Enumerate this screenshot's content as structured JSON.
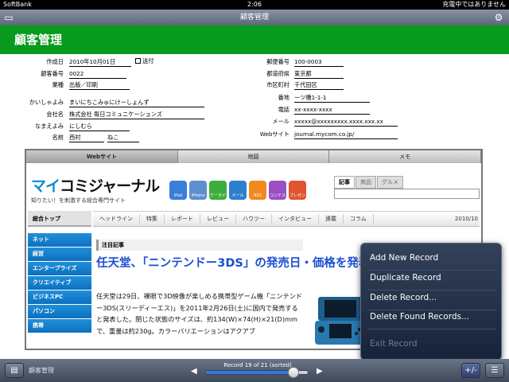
{
  "status_bar": {
    "carrier": "SoftBank",
    "time": "2:06",
    "charging": "充電中ではありません"
  },
  "title_bar": {
    "title": "顧客管理"
  },
  "header": {
    "title": "顧客管理"
  },
  "form_left": [
    {
      "label": "作成日",
      "value": "2010年10月01日"
    },
    {
      "label": "顧客番号",
      "value": "0022"
    },
    {
      "label": "業種",
      "value": "出版／印刷"
    },
    {
      "label": "かいしゃよみ",
      "value": "まいにちこみゅにけーしょんず"
    },
    {
      "label": "会社名",
      "value": "株式会社 毎日コミュニケーションズ"
    },
    {
      "label": "なまえよみ",
      "value": "にしむら"
    },
    {
      "label": "名前",
      "value_last": "西村",
      "value_first": "ねこ"
    }
  ],
  "sent_checkbox_label": "送付",
  "form_right": [
    {
      "label": "郵便番号",
      "value": "100-0003"
    },
    {
      "label": "都道府県",
      "value": "東京都"
    },
    {
      "label": "市区町村",
      "value": "千代田区"
    },
    {
      "label": "番地",
      "value": "一ツ橋1-1-1"
    },
    {
      "label": "電話",
      "value": "xx-xxxx-xxxx"
    },
    {
      "label": "メール",
      "value": "xxxxx@xxxxxxxxx.xxxx.xxx.xx"
    },
    {
      "label": "Webサイト",
      "value": "journal.mycom.co.jp/"
    }
  ],
  "tabs": [
    {
      "label": "Webサイト",
      "active": true
    },
    {
      "label": "地図",
      "active": false
    },
    {
      "label": "メモ",
      "active": false
    }
  ],
  "website": {
    "logo_mai": "マイ",
    "logo_rest": "コミジャーナル",
    "tagline": "知りたい！を刺激する総合専門サイト",
    "icons": [
      {
        "label": "iPad",
        "color": "#3a7fd8"
      },
      {
        "label": "iPhone",
        "color": "#5c8fd0"
      },
      {
        "label": "ケータイ",
        "color": "#3cae3c"
      },
      {
        "label": "メール",
        "color": "#2f7fcf"
      },
      {
        "label": "RSS",
        "color": "#f08a1c"
      },
      {
        "label": "コンテスト",
        "color": "#9a4fc4"
      },
      {
        "label": "プレゼント",
        "color": "#e0542f"
      }
    ],
    "search_tabs": [
      "記事",
      "商品",
      "グルメ"
    ],
    "sidebar_head": "総合トップ",
    "sidebar_items": [
      "ネット",
      "経営",
      "エンタープライズ",
      "クリエイティブ",
      "ビジネスPC",
      "パソコン",
      "携帯"
    ],
    "nav_items": [
      "ヘッドライン",
      "特集",
      "レポート",
      "レビュー",
      "ハウツー",
      "インタビュー",
      "連載",
      "コラム"
    ],
    "nav_date": "2010/10",
    "featured_label": "注目記事",
    "headline": "任天堂、「ニンテンドー3DS」の発売日・価格を発表",
    "article": "任天堂は29日、裸眼で3D映像が楽しめる携帯型ゲーム機「ニンテンドー3DS(スリーディーエス)」を2011年2月26日(土)に国内で発売すると発表した。閉じた状態のサイズは、約134(W)×74(H)×21(D)mmで、重量は約230g。カラーバリエーションはアクアブ"
  },
  "popover": {
    "items": [
      {
        "label": "Add New Record",
        "enabled": true
      },
      {
        "label": "Duplicate Record",
        "enabled": true
      },
      {
        "label": "Delete Record...",
        "enabled": true
      },
      {
        "label": "Delete Found Records...",
        "enabled": true
      },
      {
        "label": "Exit Record",
        "enabled": false
      }
    ]
  },
  "bottom_bar": {
    "layout_name": "顧客管理",
    "record_text": "Record 19 of 21 (sorted)",
    "record_position": 0.86
  }
}
